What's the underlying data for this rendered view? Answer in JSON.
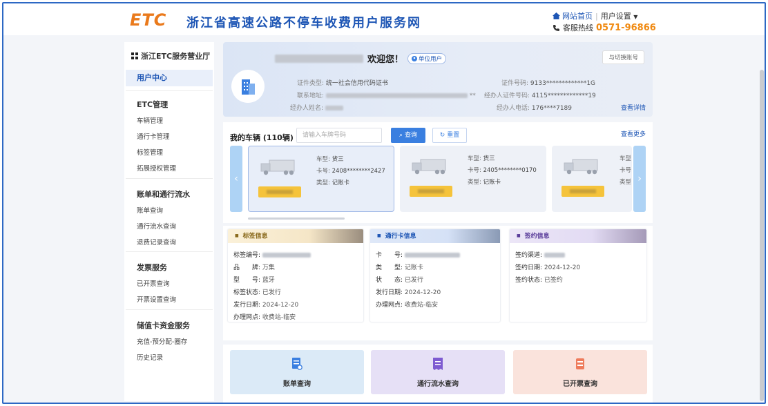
{
  "header": {
    "logo": "ETC",
    "site_title": "浙江省高速公路不停车收费用户服务网",
    "nav_home": "网站首页",
    "nav_separator": "|",
    "nav_settings": "用户设置",
    "hotline_label": "客服热线",
    "hotline_number": "0571-96866"
  },
  "sidebar": {
    "title": "浙江ETC服务营业厅",
    "active": "用户中心",
    "groups": [
      {
        "label": "ETC管理",
        "items": [
          "车辆管理",
          "通行卡管理",
          "标签管理",
          "拓展授权管理"
        ]
      },
      {
        "label": "账单和通行流水",
        "items": [
          "账单查询",
          "通行流水查询",
          "退费记录查询"
        ]
      },
      {
        "label": "发票服务",
        "items": [
          "已开票查询",
          "开票设置查询"
        ]
      },
      {
        "label": "储值卡资金服务",
        "items": [
          "充值-预分配-圈存",
          "历史记录"
        ]
      }
    ]
  },
  "profile": {
    "welcome": "欢迎您！",
    "badge": "单位用户",
    "switch_account": "与切换账号",
    "id_type_label": "证件类型:",
    "id_type_value": "统一社会信用代码证书",
    "address_label": "联系地址:",
    "agent_name_label": "经办人姓名:",
    "id_number_label": "证件号码:",
    "id_number_value": "9133*************1G",
    "agent_id_label": "经办人证件号码:",
    "agent_id_value": "4115*************19",
    "agent_phone_label": "经办人电话:",
    "agent_phone_value": "176****7189",
    "details_link": "查看详情"
  },
  "vehicles": {
    "title": "我的车辆 (110辆)",
    "search_placeholder": "请输入车牌号码",
    "query_button": "查询",
    "reset_button": "重置",
    "more_link": "查看更多",
    "cards": [
      {
        "model_label": "车型:",
        "model": "货三",
        "card_label": "卡号:",
        "card_no": "2408********2427",
        "type_label": "类型:",
        "type": "记账卡"
      },
      {
        "model_label": "车型:",
        "model": "货三",
        "card_label": "卡号:",
        "card_no": "2405********0170",
        "type_label": "类型:",
        "type": "记账卡"
      },
      {
        "model_label": "车型",
        "model": "",
        "card_label": "卡号",
        "card_no": "",
        "type_label": "类型",
        "type": ""
      }
    ]
  },
  "tag_info": {
    "title": "标签信息",
    "rows": [
      {
        "label": "标签编号:",
        "value": ""
      },
      {
        "label": "品　　牌:",
        "value": "万集"
      },
      {
        "label": "型　　号:",
        "value": "蓝牙"
      },
      {
        "label": "标签状态:",
        "value": "已发行"
      },
      {
        "label": "发行日期:",
        "value": "2024-12-20"
      },
      {
        "label": "办理网点:",
        "value": "收费站-临安"
      }
    ]
  },
  "card_info": {
    "title": "通行卡信息",
    "rows": [
      {
        "label": "卡　　号:",
        "value": ""
      },
      {
        "label": "类　　型:",
        "value": "记账卡"
      },
      {
        "label": "状　　态:",
        "value": "已发行"
      },
      {
        "label": "发行日期:",
        "value": "2024-12-20"
      },
      {
        "label": "办理网点:",
        "value": "收费站-临安"
      }
    ]
  },
  "sign_info": {
    "title": "签约信息",
    "rows": [
      {
        "label": "签约渠道:",
        "value": ""
      },
      {
        "label": "签约日期:",
        "value": "2024-12-20"
      },
      {
        "label": "签约状态:",
        "value": "已签约"
      }
    ]
  },
  "quick_links": [
    "账单查询",
    "通行流水查询",
    "已开票查询"
  ],
  "colors": {
    "brand_blue": "#1e56b5",
    "accent_orange": "#f08a12",
    "plate_yellow": "#f5c33b"
  }
}
